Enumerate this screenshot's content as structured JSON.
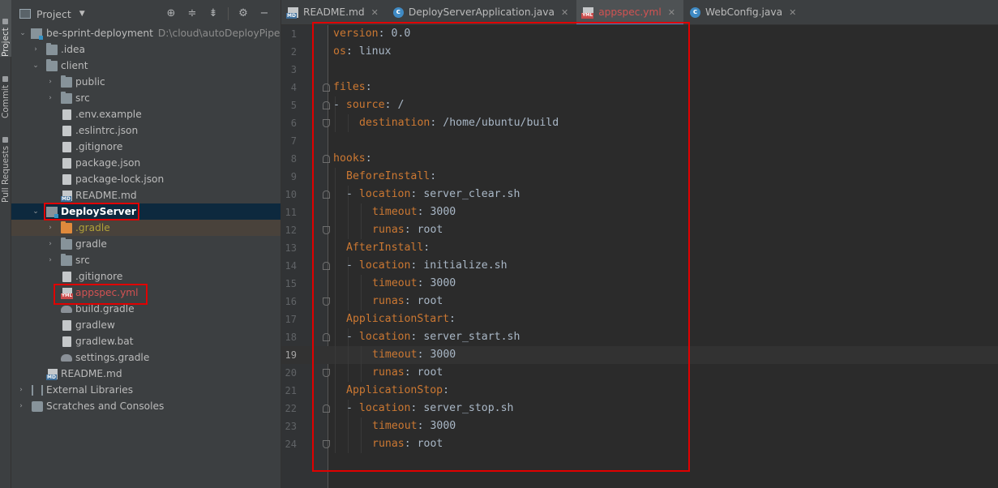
{
  "stripe": {
    "tabs": [
      "Project",
      "Commit",
      "Pull Requests"
    ]
  },
  "panel": {
    "title": "Project",
    "tools": [
      "locate-icon",
      "expand-all-icon",
      "collapse-all-icon",
      "gear-icon",
      "minimize-icon"
    ]
  },
  "tree": {
    "root": {
      "label": "be-sprint-deployment",
      "path": "D:\\cloud\\autoDeployPipe"
    },
    "idea": ".idea",
    "client": "client",
    "public": "public",
    "src": "src",
    "env": ".env.example",
    "eslint": ".eslintrc.json",
    "gitignore": ".gitignore",
    "pkg": "package.json",
    "pkglock": "package-lock.json",
    "readme": "README.md",
    "deploy": "DeployServer",
    "d_gradle_dir": ".gradle",
    "d_gradle": "gradle",
    "d_src": "src",
    "d_gitignore": ".gitignore",
    "d_appspec": "appspec.yml",
    "d_build": "build.gradle",
    "d_gradlew": "gradlew",
    "d_gradlewbat": "gradlew.bat",
    "d_settings": "settings.gradle",
    "root_readme": "README.md",
    "ext": "External Libraries",
    "scratch": "Scratches and Consoles"
  },
  "tabs": [
    {
      "label": "README.md",
      "icon": "markdown-icon"
    },
    {
      "label": "DeployServerApplication.java",
      "icon": "java-class-icon"
    },
    {
      "label": "appspec.yml",
      "icon": "yaml-icon"
    },
    {
      "label": "WebConfig.java",
      "icon": "java-class-icon"
    }
  ],
  "editor": {
    "current_line": 19,
    "lines": [
      {
        "n": "1",
        "key": "version",
        "val": "0.0"
      },
      {
        "n": "2",
        "key": "os",
        "val": "linux"
      },
      {
        "n": "3"
      },
      {
        "n": "4",
        "key": "files",
        "val": ""
      },
      {
        "n": "5",
        "dash": "- ",
        "key": "source",
        "val": "/"
      },
      {
        "n": "6",
        "key": "destination",
        "val": "/home/ubuntu/build"
      },
      {
        "n": "7"
      },
      {
        "n": "8",
        "key": "hooks",
        "val": ""
      },
      {
        "n": "9",
        "key": "BeforeInstall",
        "val": ""
      },
      {
        "n": "10",
        "dash": "- ",
        "key": "location",
        "val": "server_clear.sh"
      },
      {
        "n": "11",
        "key": "timeout",
        "val": "3000"
      },
      {
        "n": "12",
        "key": "runas",
        "val": "root"
      },
      {
        "n": "13",
        "key": "AfterInstall",
        "val": ""
      },
      {
        "n": "14",
        "dash": "- ",
        "key": "location",
        "val": "initialize.sh"
      },
      {
        "n": "15",
        "key": "timeout",
        "val": "3000"
      },
      {
        "n": "16",
        "key": "runas",
        "val": "root"
      },
      {
        "n": "17",
        "key": "ApplicationStart",
        "val": ""
      },
      {
        "n": "18",
        "dash": "- ",
        "key": "location",
        "val": "server_start.sh"
      },
      {
        "n": "19",
        "key": "timeout",
        "val": "3000"
      },
      {
        "n": "20",
        "key": "runas",
        "val": "root"
      },
      {
        "n": "21",
        "key": "ApplicationStop",
        "val": ""
      },
      {
        "n": "22",
        "dash": "- ",
        "key": "location",
        "val": "server_stop.sh"
      },
      {
        "n": "23",
        "key": "timeout",
        "val": "3000"
      },
      {
        "n": "24",
        "key": "runas",
        "val": "root"
      }
    ]
  },
  "colors": {
    "highlight_box": "#e00000",
    "key": "#cc7832",
    "value": "#a9b7c6",
    "selection": "#0d293e"
  }
}
